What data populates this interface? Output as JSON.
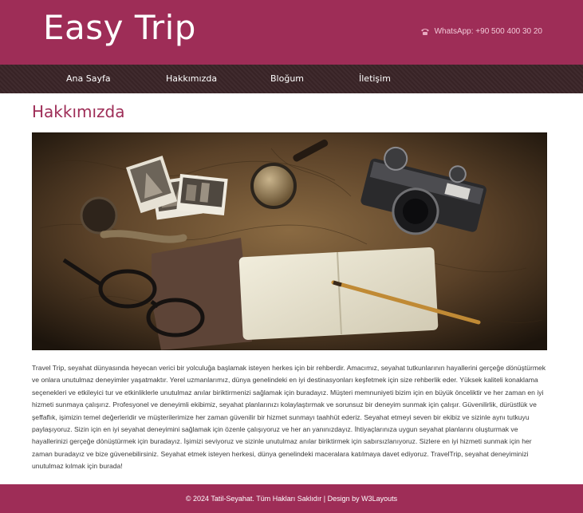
{
  "header": {
    "logo": "Easy Trip",
    "whatsapp": "WhatsApp: +90 500 400 30 20"
  },
  "nav": {
    "items": [
      {
        "label": "Ana Sayfa"
      },
      {
        "label": "Hakkımızda"
      },
      {
        "label": "Bloğum"
      },
      {
        "label": "İletişim"
      }
    ]
  },
  "main": {
    "title": "Hakkımızda",
    "image_icon": "travel-desk-photo",
    "body": "Travel Trip, seyahat dünyasında heyecan verici bir yolculuğa başlamak isteyen herkes için bir rehberdir. Amacımız, seyahat tutkunlarının hayallerini gerçeğe dönüştürmek ve onlara unutulmaz deneyimler yaşatmaktır. Yerel uzmanlarımız, dünya genelindeki en iyi destinasyonları keşfetmek için size rehberlik eder. Yüksek kaliteli konaklama seçenekleri ve etkileyici tur ve etkinliklerle unutulmaz anılar biriktirmenizi sağlamak için buradayız. Müşteri memnuniyeti bizim için en büyük önceliktir ve her zaman en iyi hizmeti sunmaya çalışırız. Profesyonel ve deneyimli ekibimiz, seyahat planlarınızı kolaylaştırmak ve sorunsuz bir deneyim sunmak için çalışır. Güvenilirlik, dürüstlük ve şeffaflık, işimizin temel değerleridir ve müşterilerimize her zaman güvenilir bir hizmet sunmayı taahhüt ederiz. Seyahat etmeyi seven bir ekibiz ve sizinle aynı tutkuyu paylaşıyoruz. Sizin için en iyi seyahat deneyimini sağlamak için özenle çalışıyoruz ve her an yanınızdayız. İhtiyaçlarınıza uygun seyahat planlarını oluşturmak ve hayallerinizi gerçeğe dönüştürmek için buradayız. İşimizi seviyoruz ve sizinle unutulmaz anılar biriktirmek için sabırsızlanıyoruz. Sizlere en iyi hizmeti sunmak için her zaman buradayız ve bize güvenebilirsiniz. Seyahat etmek isteyen herkesi, dünya genelindeki maceralara katılmaya davet ediyoruz. TravelTrip, seyahat deneyiminizi unutulmaz kılmak için burada!"
  },
  "footer": {
    "text": "© 2024 Tatil-Seyahat. Tüm Hakları Saklıdır | Design by W3Layouts"
  },
  "colors": {
    "brand": "#9e2d57",
    "nav_bg": "#3a2427",
    "title": "#9e2d57"
  }
}
